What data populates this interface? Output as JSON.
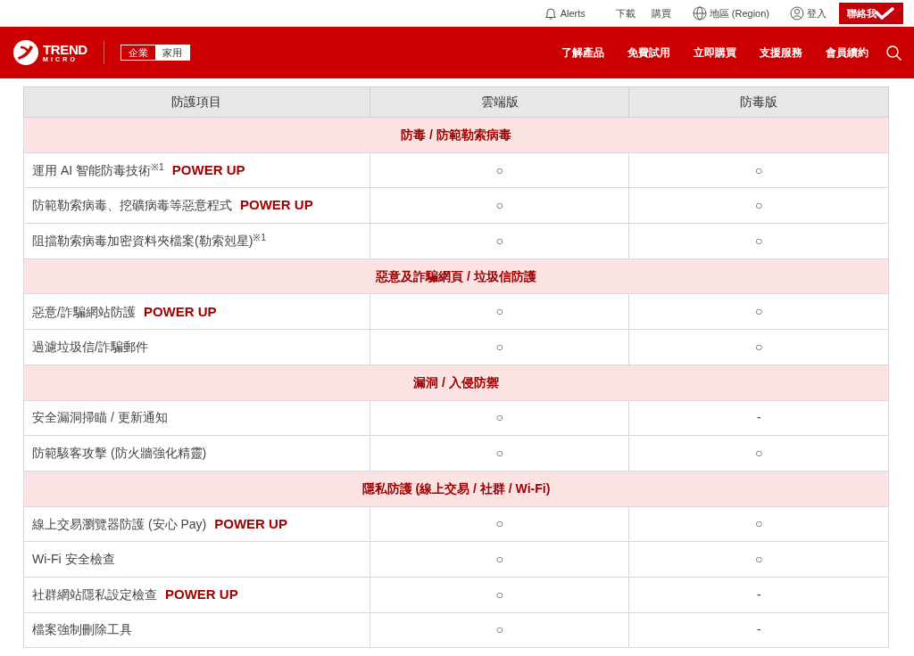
{
  "top_bar": {
    "alerts": "Alerts",
    "links": [
      "下載",
      "購買"
    ],
    "region": "地區 (Region)",
    "login": "登入",
    "contact": "聯絡我"
  },
  "nav": {
    "brand": [
      "TREND",
      "MICRO"
    ],
    "segments": [
      {
        "label": "企業",
        "selected": false
      },
      {
        "label": "家用",
        "selected": true
      }
    ],
    "items": [
      "了解產品",
      "免費試用",
      "立即購買",
      "支援服務",
      "會員續約"
    ]
  },
  "table": {
    "columns": [
      "防護項目",
      "雲端版",
      "防毒版"
    ],
    "rows": [
      {
        "kind": "section",
        "label": "防毒 / 防範勒索病毒"
      },
      {
        "kind": "item",
        "label": "運用 AI 智能防毒技術$^{※1}$",
        "tag": "POWER UP",
        "values": [
          "○",
          "○"
        ]
      },
      {
        "kind": "item",
        "label": "防範勒索病毒、挖礦病毒等惡意程式",
        "tag": "POWER UP",
        "values": [
          "○",
          "○"
        ]
      },
      {
        "kind": "item",
        "label": "阻擋勒索病毒加密資料夾檔案(勒索剋星)$^{※1}$",
        "values": [
          "○",
          "○"
        ]
      },
      {
        "kind": "section",
        "label": "惡意及詐騙網頁 / 垃圾信防護"
      },
      {
        "kind": "item",
        "label": "惡意/詐騙網站防護",
        "tag": "POWER UP",
        "values": [
          "○",
          "○"
        ]
      },
      {
        "kind": "item",
        "label": "過濾垃圾信/詐騙郵件",
        "values": [
          "○",
          "○"
        ]
      },
      {
        "kind": "section",
        "label": "漏洞 / 入侵防禦"
      },
      {
        "kind": "item",
        "label": "安全漏洞掃瞄 / 更新通知",
        "values": [
          "○",
          "-"
        ]
      },
      {
        "kind": "item",
        "label": "防範駭客攻擊 (防火牆強化精靈)",
        "values": [
          "○",
          "○"
        ]
      },
      {
        "kind": "section",
        "label": "隱私防護 (線上交易 / 社群 / Wi-Fi)"
      },
      {
        "kind": "item",
        "label": "線上交易瀏覽器防護 (安心 Pay)",
        "tag": "POWER UP",
        "values": [
          "○",
          "○"
        ]
      },
      {
        "kind": "item",
        "label": "Wi-Fi 安全檢查",
        "values": [
          "○",
          "○"
        ]
      },
      {
        "kind": "item",
        "label": "社群網站隱私設定檢查",
        "tag": "POWER UP",
        "values": [
          "○",
          "-"
        ]
      },
      {
        "kind": "item",
        "label": "檔案強制刪除工具",
        "values": [
          "○",
          "-"
        ]
      }
    ]
  }
}
